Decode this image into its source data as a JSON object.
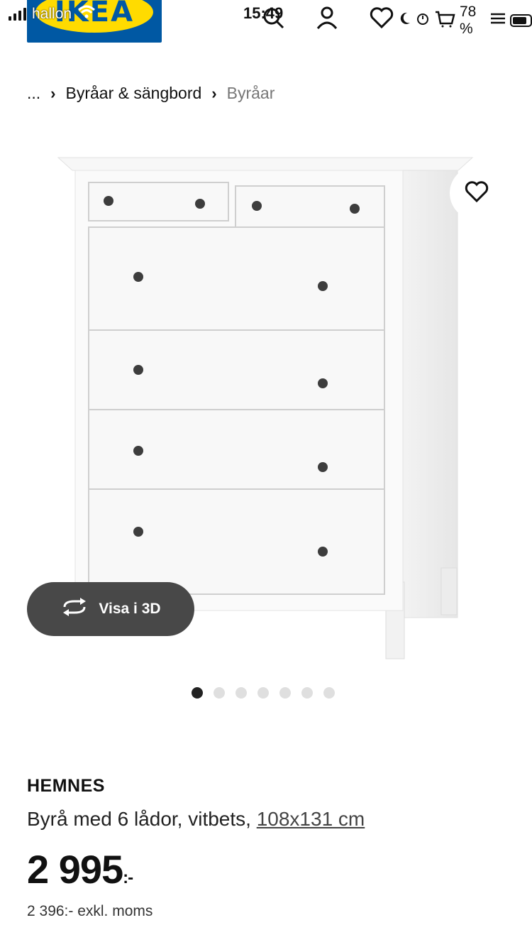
{
  "status_bar": {
    "carrier": "hallon",
    "time": "15:49",
    "battery": "78 %",
    "icons": [
      "signal-icon",
      "wifi-icon",
      "moon-icon",
      "alarm-icon",
      "battery-icon"
    ]
  },
  "header": {
    "logo": "IKEA",
    "icons": [
      "search-icon",
      "account-icon",
      "wishlist-icon",
      "cart-icon",
      "menu-icon"
    ]
  },
  "breadcrumb": {
    "ellipsis": "...",
    "level1": "Byråar & sängbord",
    "level2": "Byråar"
  },
  "gallery": {
    "view3d_label": "Visa i 3D",
    "image_count": 7,
    "active_index": 0
  },
  "product": {
    "name": "HEMNES",
    "description": "Byrå med 6 lådor, vitbets, ",
    "size": "108x131 cm",
    "price": "2 995",
    "price_suffix": ":-",
    "price_excl_vat": "2 396:- exkl. moms"
  },
  "colors": {
    "ikea_blue": "#0058a3",
    "ikea_yellow": "#ffdb00",
    "view3d_bg": "#484848"
  }
}
